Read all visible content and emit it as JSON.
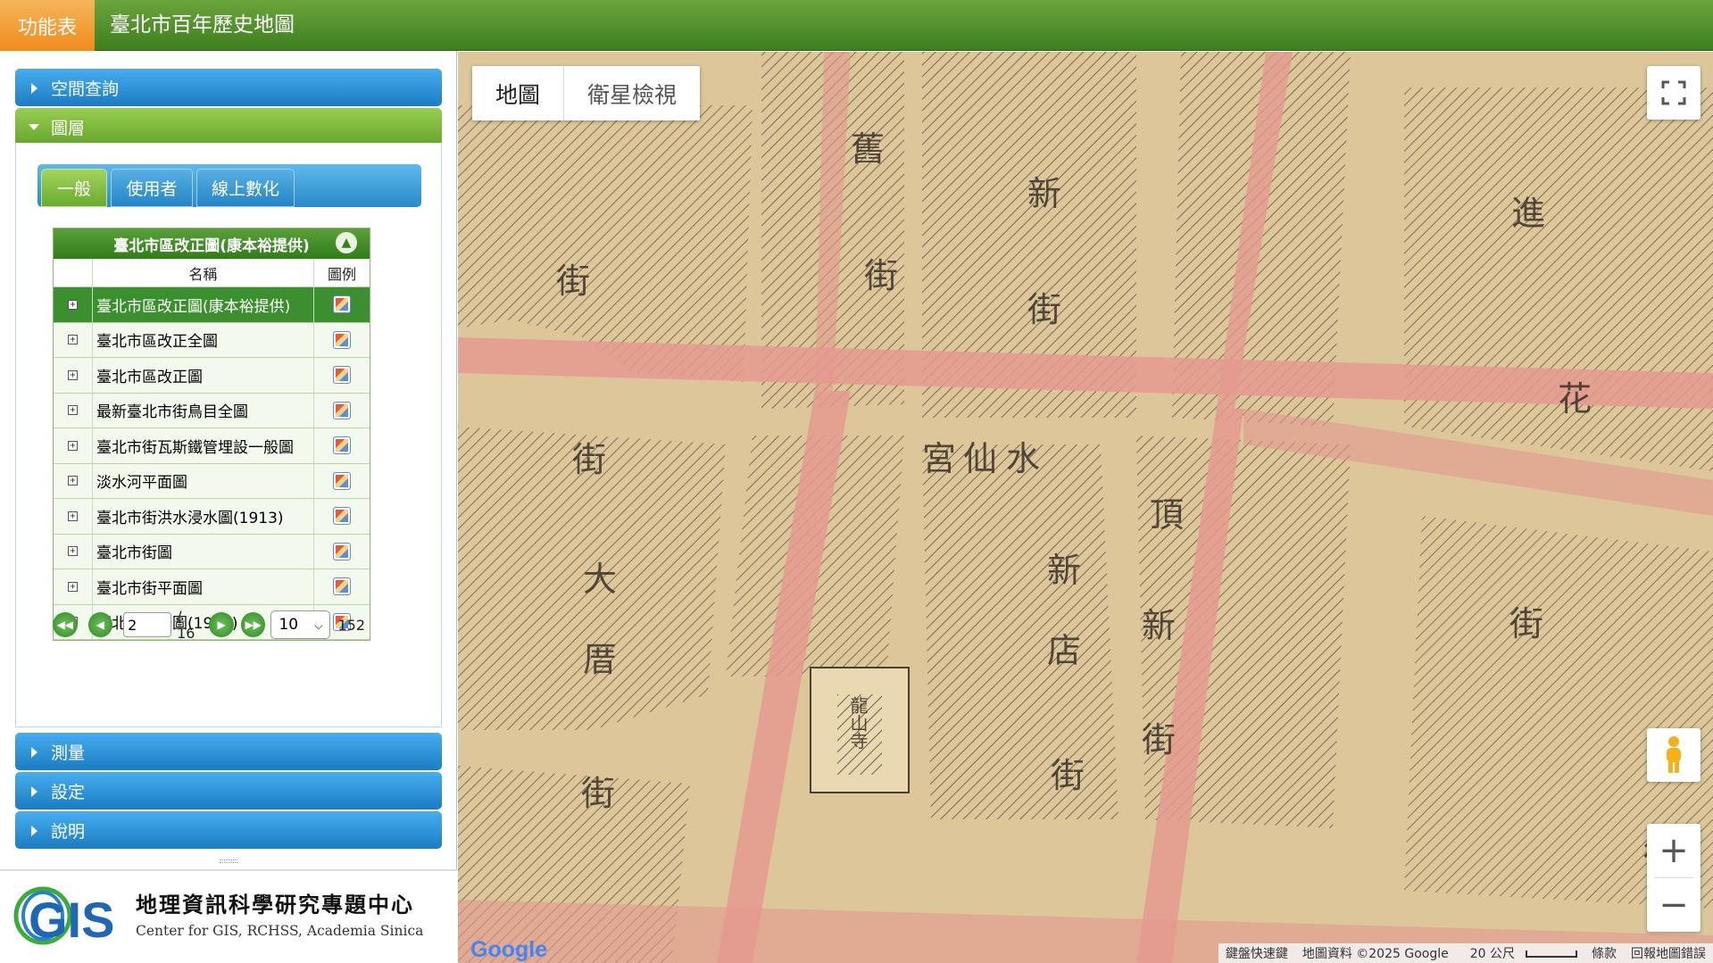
{
  "header": {
    "menu_label": "功能表",
    "app_title": "臺北市百年歷史地圖"
  },
  "sidebar": {
    "accordions": [
      {
        "label": "空間查詢",
        "open": false
      },
      {
        "label": "圖層",
        "open": true
      },
      {
        "label": "測量",
        "open": false
      },
      {
        "label": "設定",
        "open": false
      },
      {
        "label": "說明",
        "open": false
      }
    ],
    "tabs": [
      {
        "label": "一般",
        "active": true
      },
      {
        "label": "使用者",
        "active": false
      },
      {
        "label": "線上數化",
        "active": false
      }
    ],
    "layer_table": {
      "title": "臺北市區改正圖(康本裕提供)",
      "col_name": "名稱",
      "col_legend": "圖例",
      "rows": [
        {
          "name": "臺北市區改正圖(康本裕提供)",
          "selected": true
        },
        {
          "name": "臺北市區改正全圖",
          "selected": false
        },
        {
          "name": "臺北市區改正圖",
          "selected": false
        },
        {
          "name": "最新臺北市街鳥目全圖",
          "selected": false
        },
        {
          "name": "臺北市街瓦斯鐵管埋設一般圖",
          "selected": false
        },
        {
          "name": "淡水河平面圖",
          "selected": false
        },
        {
          "name": "臺北市街洪水浸水圖(1913)",
          "selected": false
        },
        {
          "name": "臺北市街圖",
          "selected": false
        },
        {
          "name": "臺北市街平面圖",
          "selected": false
        },
        {
          "name": "臺北市街全圖(1919)",
          "selected": false
        }
      ]
    },
    "pager": {
      "current_page": "2",
      "total_pages_text": "/ 16",
      "page_size": "10",
      "total_count": "152"
    }
  },
  "logo": {
    "mark": "GIS",
    "name_zh": "地理資訊科學研究專題中心",
    "name_en": "Center for GIS, RCHSS, Academia Sinica"
  },
  "map": {
    "type_tabs": [
      "地圖",
      "衛星檢視"
    ],
    "google_brand": "Google",
    "footer": {
      "shortcuts": "鍵盤快速鍵",
      "attribution": "地圖資料 ©2025 Google",
      "scale": "20 公尺",
      "terms": "條款",
      "report": "回報地圖錯誤"
    },
    "labels": [
      {
        "text": "舊",
        "id": "lbl-1"
      },
      {
        "text": "街",
        "id": "lbl-2"
      },
      {
        "text": "新",
        "id": "lbl-3"
      },
      {
        "text": "街",
        "id": "lbl-4"
      },
      {
        "text": "進",
        "id": "lbl-5"
      },
      {
        "text": "花",
        "id": "lbl-6"
      },
      {
        "text": "街",
        "id": "lbl-7"
      },
      {
        "text": "街",
        "id": "lbl-8"
      },
      {
        "text": "宮",
        "id": "lbl-9"
      },
      {
        "text": "仙",
        "id": "lbl-10"
      },
      {
        "text": "水",
        "id": "lbl-11"
      },
      {
        "text": "頂",
        "id": "lbl-12"
      },
      {
        "text": "新",
        "id": "lbl-13"
      },
      {
        "text": "新",
        "id": "lbl-14"
      },
      {
        "text": "店",
        "id": "lbl-15"
      },
      {
        "text": "街",
        "id": "lbl-16"
      },
      {
        "text": "街",
        "id": "lbl-17"
      },
      {
        "text": "街",
        "id": "lbl-18"
      },
      {
        "text": "大",
        "id": "lbl-19"
      },
      {
        "text": "厝",
        "id": "lbl-20"
      },
      {
        "text": "街",
        "id": "lbl-21"
      },
      {
        "text": "龍山寺",
        "id": "lbl-22"
      },
      {
        "text": "街",
        "id": "lbl-23"
      }
    ],
    "colors": {
      "paper": "#dcc69a",
      "road": "#e59a90",
      "hatch": "#4a3f33"
    }
  }
}
